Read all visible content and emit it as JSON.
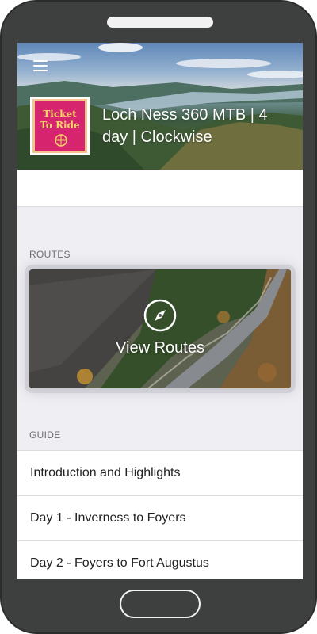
{
  "header": {
    "title": "Loch Ness 360 MTB | 4 day | Clockwise",
    "logo_text_line1": "Ticket",
    "logo_text_line2": "To Ride"
  },
  "sections": {
    "routes_label": "ROUTES",
    "guide_label": "GUIDE"
  },
  "routes_card": {
    "label": "View Routes",
    "icon": "compass-icon"
  },
  "guide": {
    "items": [
      {
        "label": "Introduction and Highlights"
      },
      {
        "label": "Day 1 - Inverness to Foyers"
      },
      {
        "label": "Day 2 - Foyers to Fort Augustus"
      }
    ]
  },
  "colors": {
    "frame": "#3e403f",
    "screen_bg": "#efeef3",
    "logo_pink": "#d6246f",
    "text_secondary": "#6d6d72"
  }
}
